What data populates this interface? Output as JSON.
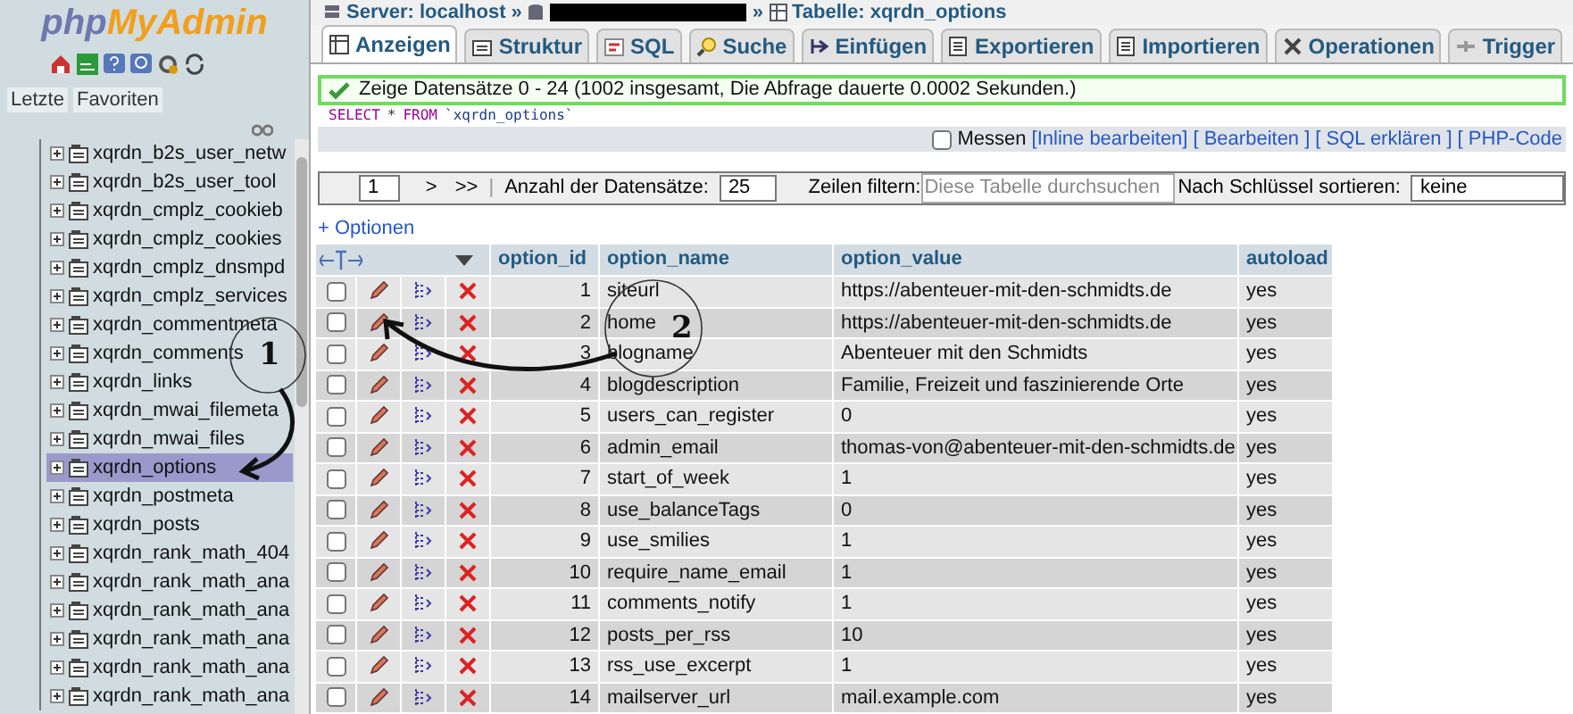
{
  "sidebar": {
    "logo": [
      "php",
      "MyAdmin"
    ],
    "tabs": [
      {
        "label": "Letzte"
      },
      {
        "label": "Favoriten"
      }
    ],
    "tables": [
      {
        "name": "xqrdn_b2s_user_netw",
        "selected": false
      },
      {
        "name": "xqrdn_b2s_user_tool",
        "selected": false
      },
      {
        "name": "xqrdn_cmplz_cookieb",
        "selected": false
      },
      {
        "name": "xqrdn_cmplz_cookies",
        "selected": false
      },
      {
        "name": "xqrdn_cmplz_dnsmpd",
        "selected": false
      },
      {
        "name": "xqrdn_cmplz_services",
        "selected": false
      },
      {
        "name": "xqrdn_commentmeta",
        "selected": false
      },
      {
        "name": "xqrdn_comments",
        "selected": false
      },
      {
        "name": "xqrdn_links",
        "selected": false
      },
      {
        "name": "xqrdn_mwai_filemeta",
        "selected": false
      },
      {
        "name": "xqrdn_mwai_files",
        "selected": false
      },
      {
        "name": "xqrdn_options",
        "selected": true
      },
      {
        "name": "xqrdn_postmeta",
        "selected": false
      },
      {
        "name": "xqrdn_posts",
        "selected": false
      },
      {
        "name": "xqrdn_rank_math_404",
        "selected": false
      },
      {
        "name": "xqrdn_rank_math_ana",
        "selected": false
      },
      {
        "name": "xqrdn_rank_math_ana",
        "selected": false
      },
      {
        "name": "xqrdn_rank_math_ana",
        "selected": false
      },
      {
        "name": "xqrdn_rank_math_ana",
        "selected": false
      },
      {
        "name": "xqrdn_rank_math_ana",
        "selected": false
      }
    ]
  },
  "breadcrumb": {
    "server": "Server: localhost",
    "separator": "»",
    "table": "Tabelle: xqrdn_options"
  },
  "tabs": [
    {
      "label": "Anzeigen",
      "selected": true
    },
    {
      "label": "Struktur",
      "selected": false
    },
    {
      "label": "SQL",
      "selected": false
    },
    {
      "label": "Suche",
      "selected": false
    },
    {
      "label": "Einfügen",
      "selected": false
    },
    {
      "label": "Exportieren",
      "selected": false
    },
    {
      "label": "Importieren",
      "selected": false
    },
    {
      "label": "Operationen",
      "selected": false
    },
    {
      "label": "Trigger",
      "selected": false
    }
  ],
  "message": "Zeige Datensätze 0 - 24 (1002 insgesamt, Die Abfrage dauerte 0.0002 Sekunden.)",
  "sql_query": [
    {
      "kind": "keyword",
      "text": "SELECT"
    },
    {
      "kind": "operator",
      "text": "*"
    },
    {
      "kind": "keyword",
      "text": "FROM"
    },
    {
      "kind": "identifier",
      "text": "`xqrdn_options`"
    }
  ],
  "query_actions": {
    "profiling": {
      "label": "Messen",
      "checked": false
    },
    "links": [
      "[Inline bearbeiten]",
      "[ Bearbeiten ]",
      "[ SQL erklären ]",
      "[ PHP-Code"
    ]
  },
  "navigation": {
    "page": "1",
    "next": ">",
    "last": ">>",
    "separator": "|",
    "rows_label": "Anzahl der Datensätze:",
    "rows_value": "25",
    "filter_label": "Zeilen filtern:",
    "filter_placeholder": "Diese Tabelle durchsuchen",
    "sort_label": "Nach Schlüssel sortieren:",
    "sort_value": "keine"
  },
  "options_link": "+ Optionen",
  "table": {
    "columns": [
      "option_id",
      "option_name",
      "option_value",
      "autoload"
    ],
    "rows": [
      {
        "checked": false,
        "cells": [
          "1",
          "siteurl",
          "https://abenteuer-mit-den-schmidts.de",
          "yes"
        ]
      },
      {
        "checked": false,
        "cells": [
          "2",
          "home",
          "https://abenteuer-mit-den-schmidts.de",
          "yes"
        ]
      },
      {
        "checked": false,
        "cells": [
          "3",
          "blogname",
          "Abenteuer mit den Schmidts",
          "yes"
        ]
      },
      {
        "checked": false,
        "cells": [
          "4",
          "blogdescription",
          "Familie, Freizeit und faszinierende Orte",
          "yes"
        ]
      },
      {
        "checked": false,
        "cells": [
          "5",
          "users_can_register",
          "0",
          "yes"
        ]
      },
      {
        "checked": false,
        "cells": [
          "6",
          "admin_email",
          "thomas-von@abenteuer-mit-den-schmidts.de",
          "yes"
        ]
      },
      {
        "checked": false,
        "cells": [
          "7",
          "start_of_week",
          "1",
          "yes"
        ]
      },
      {
        "checked": false,
        "cells": [
          "8",
          "use_balanceTags",
          "0",
          "yes"
        ]
      },
      {
        "checked": false,
        "cells": [
          "9",
          "use_smilies",
          "1",
          "yes"
        ]
      },
      {
        "checked": false,
        "cells": [
          "10",
          "require_name_email",
          "1",
          "yes"
        ]
      },
      {
        "checked": false,
        "cells": [
          "11",
          "comments_notify",
          "1",
          "yes"
        ]
      },
      {
        "checked": false,
        "cells": [
          "12",
          "posts_per_rss",
          "10",
          "yes"
        ]
      },
      {
        "checked": false,
        "cells": [
          "13",
          "rss_use_excerpt",
          "1",
          "yes"
        ]
      },
      {
        "checked": false,
        "cells": [
          "14",
          "mailserver_url",
          "mail.example.com",
          "yes"
        ]
      }
    ]
  },
  "annotations": [
    {
      "label": "1"
    },
    {
      "label": "2"
    }
  ]
}
